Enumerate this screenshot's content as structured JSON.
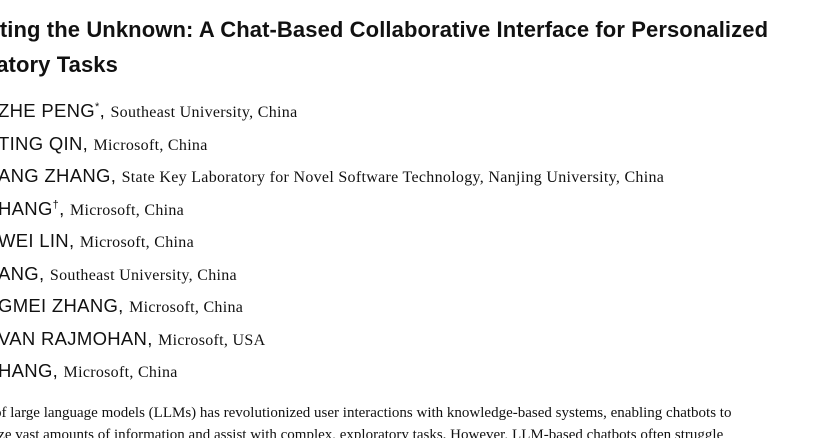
{
  "title": {
    "line1": "gating the Unknown: A Chat-Based Collaborative Interface for Personalized",
    "line2": "oratory Tasks"
  },
  "authors": [
    {
      "name": "ZHE PENG",
      "mark": "*",
      "affiliation": "Southeast University, China"
    },
    {
      "name": "TING QIN",
      "mark": "",
      "affiliation": "Microsoft, China"
    },
    {
      "name": "ANG ZHANG",
      "mark": "",
      "affiliation": "State Key Laboratory for Novel Software Technology, Nanjing University, China"
    },
    {
      "name": "HANG",
      "mark": "†",
      "affiliation": "Microsoft, China"
    },
    {
      "name": "WEI LIN",
      "mark": "",
      "affiliation": "Microsoft, China"
    },
    {
      "name": "ANG",
      "mark": "",
      "affiliation": "Southeast University, China"
    },
    {
      "name": "GMEI ZHANG",
      "mark": "",
      "affiliation": "Microsoft, China"
    },
    {
      "name": "VAN RAJMOHAN",
      "mark": "",
      "affiliation": "Microsoft, USA"
    },
    {
      "name": "HANG",
      "mark": "",
      "affiliation": "Microsoft, China"
    }
  ],
  "abstract": {
    "line1": "of large language models (LLMs) has revolutionized user interactions with knowledge-based systems, enabling chatbots to",
    "line2": "ize vast amounts of information and assist with complex, exploratory tasks. However, LLM-based chatbots often struggle"
  }
}
